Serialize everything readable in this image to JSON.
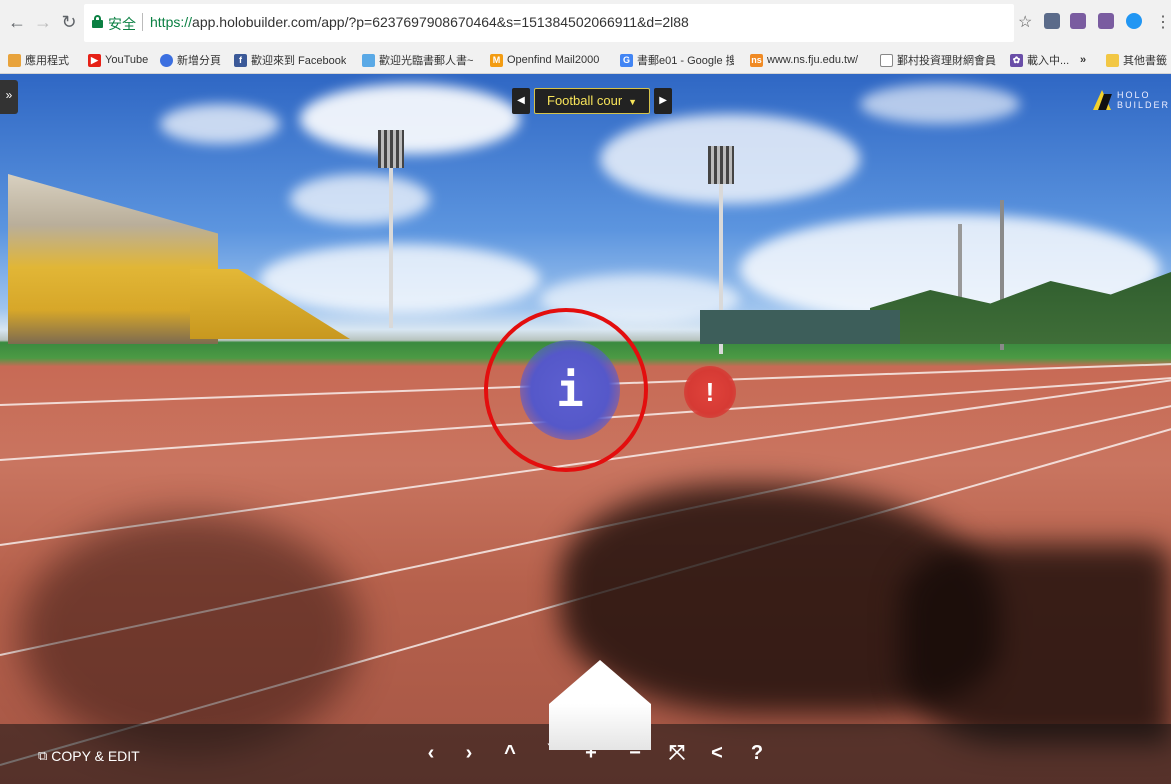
{
  "browser": {
    "secure_label": "安全",
    "url_scheme": "https://",
    "url_rest": "app.holobuilder.com/app/?p=6237697908670464&s=151384502066911&d=2l88",
    "back_icon": "arrow-left-icon",
    "forward_icon": "arrow-right-icon",
    "reload_icon": "reload-icon"
  },
  "bookmarks": [
    {
      "label": "應用程式",
      "icon": "apps-icon",
      "color": "#e8a33c"
    },
    {
      "label": "YouTube",
      "icon": "youtube-icon",
      "color": "#e62117"
    },
    {
      "label": "新增分頁",
      "icon": "new-tab-icon",
      "color": "#3b6fe0"
    },
    {
      "label": "歡迎來到 Facebook",
      "icon": "facebook-icon",
      "color": "#3b5998"
    },
    {
      "label": "歡迎光臨書郵人書~",
      "icon": "bookmark-icon",
      "color": "#5aa9e6"
    },
    {
      "label": "Openfind Mail2000",
      "icon": "mail-icon",
      "color": "#f39c12"
    },
    {
      "label": "書郵e01 - Google 搜",
      "icon": "google-icon",
      "color": "#4285f4"
    },
    {
      "label": "www.ns.fju.edu.tw/",
      "icon": "ns-icon",
      "color": "#f08a24"
    },
    {
      "label": "鄞村投資理財網會員",
      "icon": "page-icon",
      "color": "#ffffff"
    },
    {
      "label": "載入中...",
      "icon": "loading-icon",
      "color": "#6a4ea8"
    },
    {
      "label": "»",
      "icon": "",
      "color": ""
    },
    {
      "label": "其他書籤",
      "icon": "folder-icon",
      "color": "#f2c744"
    }
  ],
  "viewer": {
    "scene_name": "Football cour",
    "logo_line1": "HOLO",
    "logo_line2": "BUILDER",
    "info_glyph": "i",
    "alert_glyph": "!",
    "copy_edit": "COPY & EDIT",
    "tools": [
      {
        "name": "prev-button",
        "glyph": "‹"
      },
      {
        "name": "next-button",
        "glyph": "›"
      },
      {
        "name": "up-button",
        "glyph": "^"
      },
      {
        "name": "down-button",
        "glyph": "ˇ"
      },
      {
        "name": "zoom-in-button",
        "glyph": "+"
      },
      {
        "name": "zoom-out-button",
        "glyph": "−"
      },
      {
        "name": "fullscreen-button",
        "glyph": "⤧"
      },
      {
        "name": "share-button",
        "glyph": "<"
      },
      {
        "name": "help-button",
        "glyph": "?"
      }
    ]
  }
}
